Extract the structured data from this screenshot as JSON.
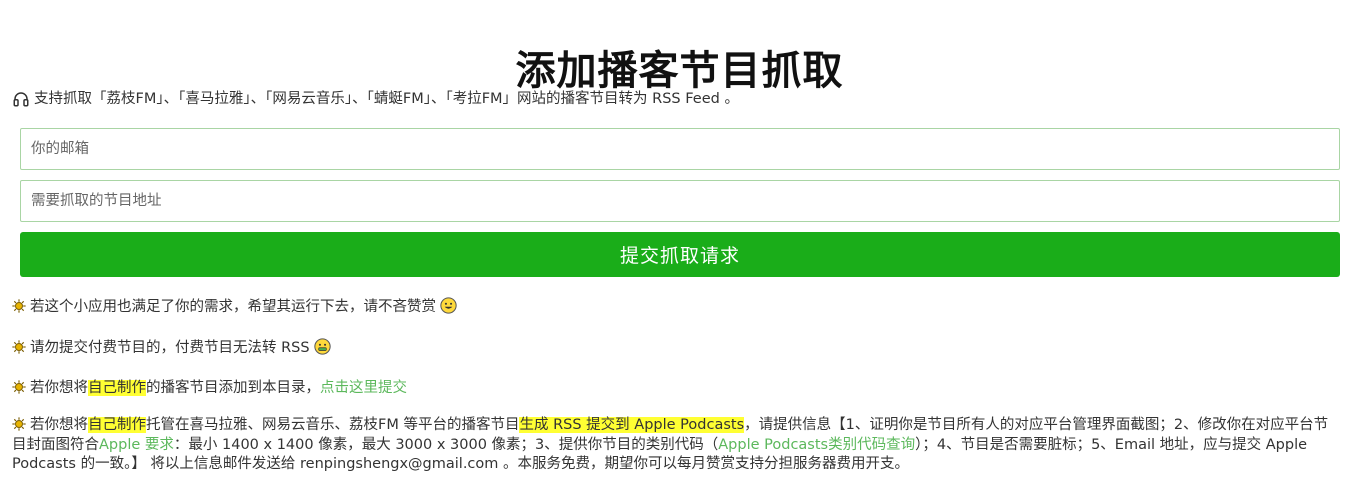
{
  "page": {
    "title": "添加播客节目抓取"
  },
  "intro": {
    "icon": "headphones-icon",
    "text": "支持抓取「荔枝FM」、「喜马拉雅」、「网易云音乐」、「蜻蜓FM」、「考拉FM」网站的播客节目转为 RSS Feed 。"
  },
  "form": {
    "email_placeholder": "你的邮箱",
    "email_value": "",
    "url_placeholder": "需要抓取的节目地址",
    "url_value": "",
    "submit_label": "提交抓取请求"
  },
  "colors": {
    "accent": "#1aad19",
    "input_border": "#a9d5a4",
    "highlight": "#ffff33",
    "link": "#5cb85c"
  },
  "notes": {
    "icon": "sun-icon",
    "n1": {
      "text": "若这个小应用也满足了你的需求，希望其运行下去，请不吝赞赏",
      "emoji": "grinning-face-icon"
    },
    "n2": {
      "text": "请勿提交付费节目的，付费节目无法转 RSS",
      "emoji": "money-mouth-face-icon"
    },
    "n3": {
      "pre": "若你想将",
      "hl": "自己制作",
      "mid": "的播客节目添加到本目录，",
      "link": "点击这里提交"
    },
    "n4": {
      "pre": "若你想将",
      "hl1": "自己制作",
      "mid1": "托管在喜马拉雅、网易云音乐、荔枝FM 等平台的播客节目",
      "hl2": "生成 RSS 提交到 Apple Podcasts",
      "mid2": "，请提供信息【1、证明你是节目所有人的对应平台管理界面截图；2、修改你在对应平台节目封面图符合",
      "link1": "Apple 要求",
      "mid3": "：最小 1400 x 1400 像素，最大 3000 x 3000 像素；3、提供你节目的类别代码（",
      "link2": "Apple Podcasts类别代码查询",
      "post": "）；4、节目是否需要脏标；5、Email 地址，应与提交 Apple Podcasts 的一致。】 将以上信息邮件发送给 renpingshengx@gmail.com 。本服务免费，期望你可以每月赞赏支持分担服务器费用开支。"
    }
  }
}
